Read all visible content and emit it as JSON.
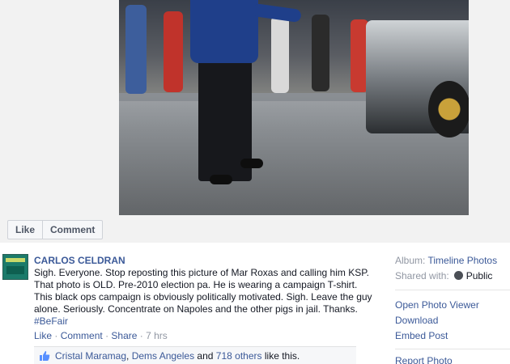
{
  "actions": {
    "like": "Like",
    "comment": "Comment"
  },
  "post": {
    "author": "CARLOS CELDRAN",
    "caption": "Sigh. Everyone. Stop reposting this picture of Mar Roxas and calling him KSP. That photo is OLD. Pre-2010 election pa. He is wearing a campaign T-shirt. This black ops campaign is obviously politically motivated. Sigh. Leave the guy alone. Seriously. Concentrate on Napoles and the other pigs in jail. Thanks.",
    "hashtag": "#BeFair",
    "meta": {
      "like": "Like",
      "comment": "Comment",
      "share": "Share",
      "time": "7 hrs"
    },
    "likes": {
      "name1": "Cristal Maramag",
      "name2": "Dems Angeles",
      "and": "and",
      "others": "718 others",
      "suffix": "like this."
    }
  },
  "sidebar": {
    "album_label": "Album:",
    "album_value": "Timeline Photos",
    "shared_label": "Shared with:",
    "shared_value": "Public",
    "open_viewer": "Open Photo Viewer",
    "download": "Download",
    "embed": "Embed Post",
    "report": "Report Photo"
  },
  "icons": {
    "like_thumb": "thumbs-up-icon",
    "privacy": "globe-icon"
  },
  "colors": {
    "link": "#3b5998",
    "muted": "#9197a3",
    "stage": "#f2f2f2"
  }
}
